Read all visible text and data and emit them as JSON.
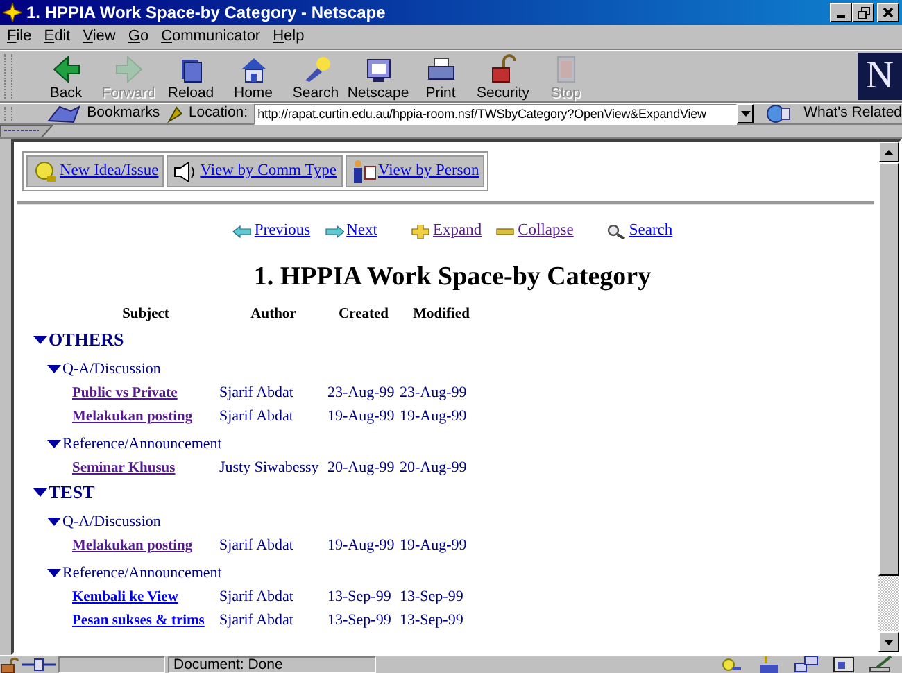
{
  "window": {
    "title": "1. HPPIA Work Space-by Category - Netscape"
  },
  "menu": [
    {
      "label": "File"
    },
    {
      "label": "Edit"
    },
    {
      "label": "View"
    },
    {
      "label": "Go"
    },
    {
      "label": "Communicator"
    },
    {
      "label": "Help"
    }
  ],
  "toolbar": [
    {
      "kind": "back",
      "label": "Back",
      "disabled": false
    },
    {
      "kind": "forward",
      "label": "Forward",
      "disabled": true
    },
    {
      "kind": "reload",
      "label": "Reload",
      "disabled": false
    },
    {
      "kind": "home",
      "label": "Home",
      "disabled": false
    },
    {
      "kind": "search",
      "label": "Search",
      "disabled": false
    },
    {
      "kind": "netscape",
      "label": "Netscape",
      "disabled": false
    },
    {
      "kind": "print",
      "label": "Print",
      "disabled": false
    },
    {
      "kind": "security",
      "label": "Security",
      "disabled": false
    },
    {
      "kind": "stop",
      "label": "Stop",
      "disabled": true
    }
  ],
  "logo": "N",
  "location_bar": {
    "bookmarks": "Bookmarks",
    "location_label": "Location:",
    "url": "http://rapat.curtin.edu.au/hppia-room.nsf/TWSbyCategory?OpenView&ExpandView",
    "related": "What's Related"
  },
  "action_buttons": [
    {
      "kind": "idea",
      "label": "New Idea/Issue"
    },
    {
      "kind": "speaker",
      "label": "View by Comm Type"
    },
    {
      "kind": "person",
      "label": "View by Person"
    }
  ],
  "nav_links": [
    {
      "kind": "previous",
      "label": "Previous",
      "visited": false
    },
    {
      "kind": "next",
      "label": "Next",
      "visited": false
    },
    {
      "kind": "expand",
      "label": "Expand",
      "visited": true
    },
    {
      "kind": "collapse",
      "label": "Collapse",
      "visited": true
    },
    {
      "kind": "search",
      "label": "Search",
      "visited": false
    }
  ],
  "heading": "1. HPPIA Work Space-by Category",
  "table": {
    "columns": [
      "Subject",
      "Author",
      "Created",
      "Modified"
    ],
    "categories": [
      {
        "label": "OTHERS",
        "expanded": true,
        "children": [
          {
            "label": "Q-A/Discussion",
            "expanded": true,
            "children": [
              {
                "subject": "Public vs Private",
                "author": "Sjarif Abdat",
                "created": "23-Aug-99",
                "modified": "23-Aug-99",
                "visited": true
              },
              {
                "subject": "Melakukan posting",
                "author": "Sjarif Abdat",
                "created": "19-Aug-99",
                "modified": "19-Aug-99",
                "visited": true
              }
            ]
          },
          {
            "label": "Reference/Announcement",
            "expanded": true,
            "children": [
              {
                "subject": "Seminar Khusus",
                "author": "Justy Siwabessy",
                "created": "20-Aug-99",
                "modified": "20-Aug-99",
                "visited": true
              }
            ]
          }
        ]
      },
      {
        "label": "TEST",
        "expanded": true,
        "children": [
          {
            "label": "Q-A/Discussion",
            "expanded": true,
            "children": [
              {
                "subject": "Melakukan posting",
                "author": "Sjarif Abdat",
                "created": "19-Aug-99",
                "modified": "19-Aug-99",
                "visited": true
              }
            ]
          },
          {
            "label": "Reference/Announcement",
            "expanded": true,
            "children": [
              {
                "subject": "Kembali ke View",
                "author": "Sjarif Abdat",
                "created": "13-Sep-99",
                "modified": "13-Sep-99",
                "visited": false
              },
              {
                "subject": "Pesan sukses & trims",
                "author": "Sjarif Abdat",
                "created": "13-Sep-99",
                "modified": "13-Sep-99",
                "visited": false
              }
            ]
          }
        ]
      }
    ]
  },
  "status_bar": {
    "text": "Document: Done"
  }
}
